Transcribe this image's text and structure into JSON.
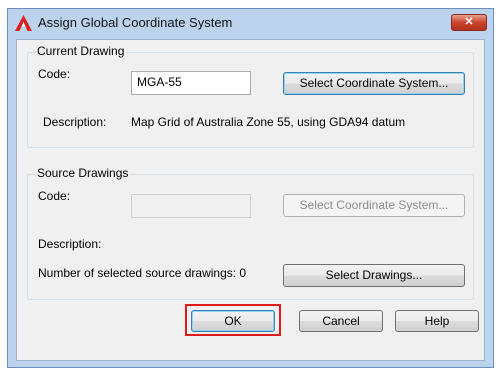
{
  "window": {
    "title": "Assign Global Coordinate System",
    "close_glyph": "✕",
    "app_icon": "autocad-a-icon",
    "accent_color": "#c9452c"
  },
  "current_drawing": {
    "group_label": "Current Drawing",
    "code_label": "Code:",
    "code_value": "MGA-55",
    "select_button": "Select Coordinate System...",
    "description_label": "Description:",
    "description_value": "Map Grid of Australia Zone 55, using GDA94 datum"
  },
  "source_drawings": {
    "group_label": "Source Drawings",
    "code_label": "Code:",
    "code_value": "",
    "select_button": "Select Coordinate System...",
    "description_label": "Description:",
    "count_label": "Number of selected source drawings: 0",
    "select_drawings_button": "Select Drawings..."
  },
  "buttons": {
    "ok": "OK",
    "cancel": "Cancel",
    "help": "Help"
  },
  "highlight_color": "#e01b1b"
}
